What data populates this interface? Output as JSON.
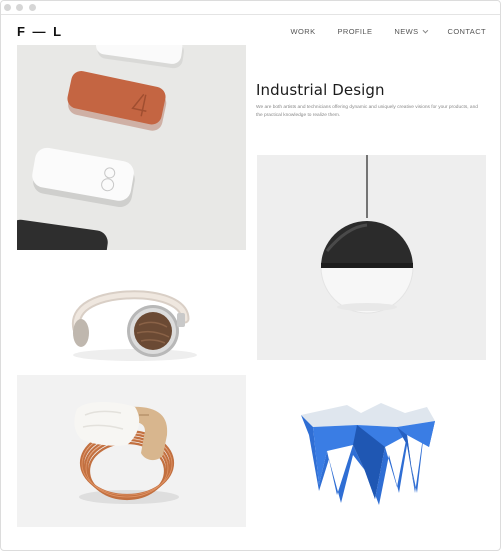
{
  "window": {
    "title": ""
  },
  "brand": {
    "logo": "F — L"
  },
  "nav": {
    "items": [
      {
        "label": "WORK"
      },
      {
        "label": "PROFILE"
      },
      {
        "label": "NEWS"
      },
      {
        "label": "CONTACT"
      }
    ]
  },
  "hero": {
    "title": "Industrial Design",
    "description": "We are both artists and technicians offering dynamic and uniquely creative visions for your products, and the practical knowledge to realize them."
  },
  "gallery": {
    "items": [
      {
        "subject": "power-bank-devices"
      },
      {
        "subject": "headphones"
      },
      {
        "subject": "pendant-lamp"
      },
      {
        "subject": "copper-coil-ring"
      },
      {
        "subject": "blue-folded-stool"
      }
    ]
  },
  "colors": {
    "accent_blue": "#2f6ed4",
    "terracotta": "#c06440",
    "copper": "#c27040",
    "lamp_dark": "#2a2a2a"
  }
}
